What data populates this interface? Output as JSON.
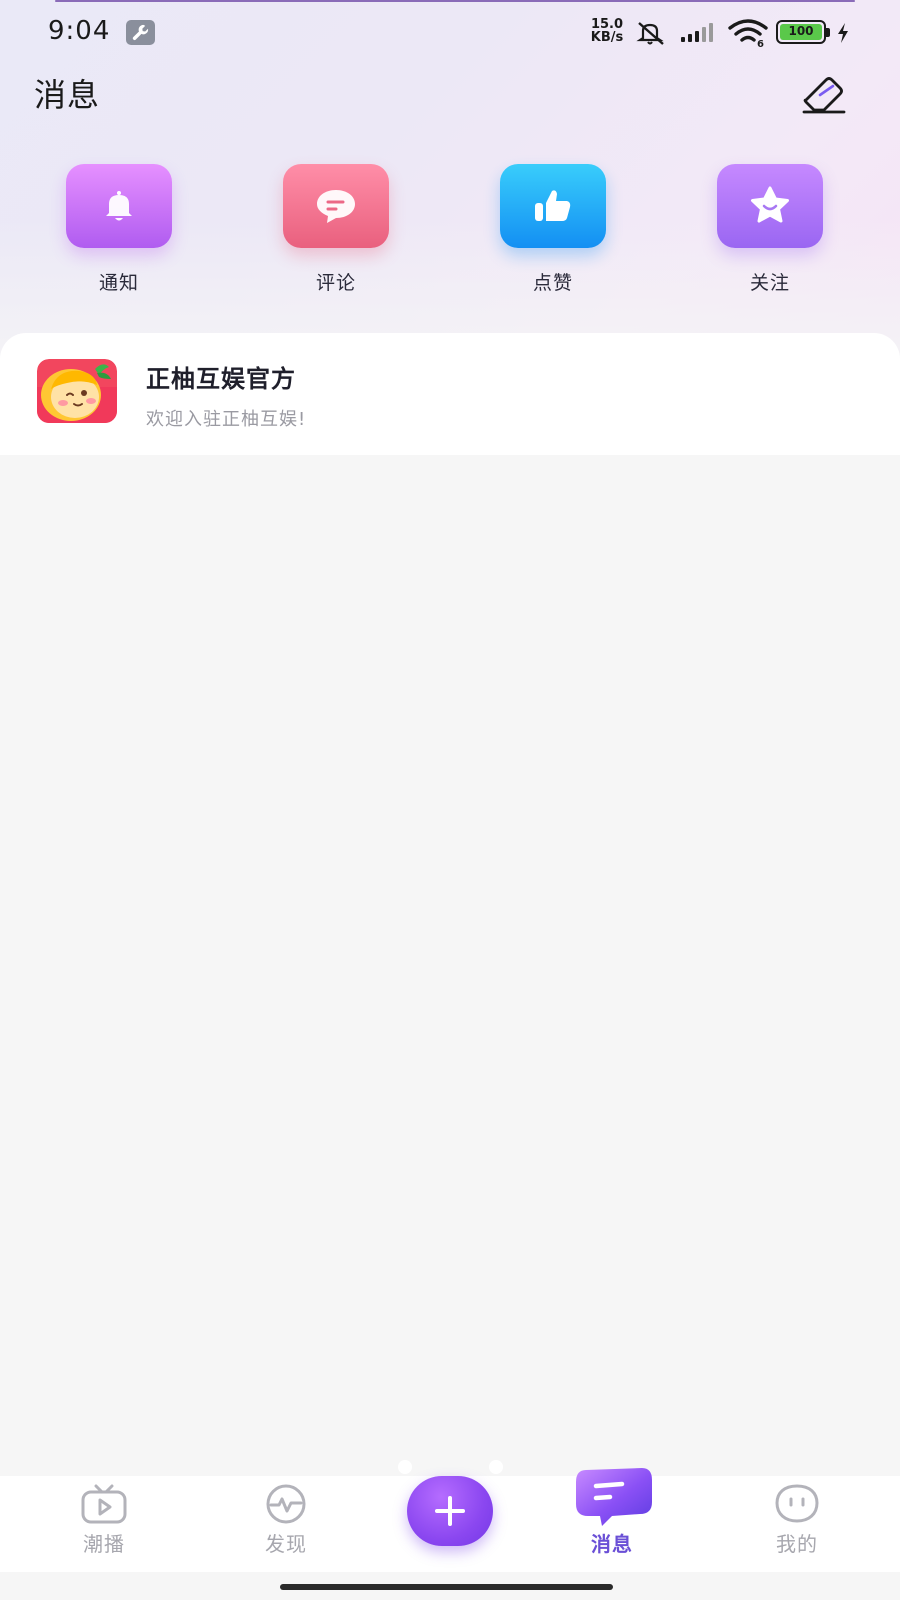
{
  "status_bar": {
    "time": "9:04",
    "net_speed_value": "15.0",
    "net_speed_unit": "KB/s",
    "battery_level": "100",
    "icons": [
      "wrench-icon",
      "mute-icon",
      "signal-icon",
      "wifi-icon",
      "battery-icon",
      "charging-icon"
    ]
  },
  "header": {
    "title": "消息",
    "clear_icon": "eraser-icon"
  },
  "quick_entries": [
    {
      "label": "通知",
      "icon": "bell-icon",
      "color": "#c36cf6"
    },
    {
      "label": "评论",
      "icon": "comment-bubble-icon",
      "color": "#f27390"
    },
    {
      "label": "点赞",
      "icon": "thumbs-up-icon",
      "color": "#21aef7"
    },
    {
      "label": "关注",
      "icon": "star-icon",
      "color": "#ad75f6"
    }
  ],
  "messages": [
    {
      "title": "正柚互娱官方",
      "preview": "欢迎入驻正柚互娱!",
      "avatar": "official-avatar"
    }
  ],
  "bottom_nav": {
    "items": [
      {
        "label": "潮播",
        "icon": "tv-icon",
        "active": false
      },
      {
        "label": "发现",
        "icon": "pulse-icon",
        "active": false
      },
      {
        "label": "",
        "icon": "plus-icon",
        "active": false
      },
      {
        "label": "消息",
        "icon": "chat-bubble-icon",
        "active": true
      },
      {
        "label": "我的",
        "icon": "face-icon",
        "active": false
      }
    ],
    "active_color": "#6a4fd6",
    "inactive_color": "#a7a7ae"
  }
}
